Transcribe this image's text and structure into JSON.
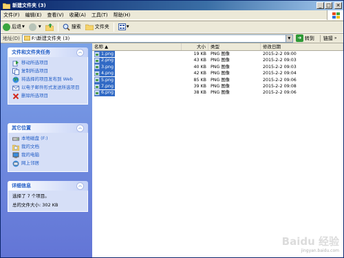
{
  "window": {
    "title": "新建文件夹 (3)",
    "buttons": [
      "_",
      "□",
      "✕"
    ]
  },
  "menu": [
    "文件(F)",
    "编辑(E)",
    "查看(V)",
    "收藏(A)",
    "工具(T)",
    "帮助(H)"
  ],
  "toolbar": {
    "back": "后退",
    "search": "搜索",
    "folders": "文件夹"
  },
  "address": {
    "label": "地址(D)",
    "path": "F:\\新建文件夹 (3)",
    "go": "转到",
    "links": "链接"
  },
  "panels": {
    "tasks": {
      "title": "文件和文件夹任务",
      "items": [
        "移动所选项目",
        "复制所选项目",
        "将选择的项目发布到 Web",
        "以电子邮件形式发送所选项目",
        "删除所选项目"
      ]
    },
    "places": {
      "title": "其它位置",
      "items": [
        "本地磁盘 (F:)",
        "我的文档",
        "我的电脑",
        "网上邻居"
      ]
    },
    "details": {
      "title": "详细信息",
      "lines": [
        "选择了 7 个项目。",
        "总的文件大小: 302 KB"
      ]
    }
  },
  "columns": {
    "name": "名称 ▲",
    "size": "大小",
    "type": "类型",
    "date": "修改日期"
  },
  "files": [
    {
      "name": "1.png",
      "size": "19 KB",
      "type": "PNG 图像",
      "date": "2015-2-2 09:00"
    },
    {
      "name": "2.png",
      "size": "43 KB",
      "type": "PNG 图像",
      "date": "2015-2-2 09:03"
    },
    {
      "name": "3.png",
      "size": "40 KB",
      "type": "PNG 图像",
      "date": "2015-2-2 09:03"
    },
    {
      "name": "4.png",
      "size": "42 KB",
      "type": "PNG 图像",
      "date": "2015-2-2 09:04"
    },
    {
      "name": "5.png",
      "size": "85 KB",
      "type": "PNG 图像",
      "date": "2015-2-2 09:06"
    },
    {
      "name": "7.png",
      "size": "39 KB",
      "type": "PNG 图像",
      "date": "2015-2-2 09:08"
    },
    {
      "name": "6.png",
      "size": "38 KB",
      "type": "PNG 图像",
      "date": "2015-2-2 09:06"
    }
  ],
  "watermark": {
    "line1": "Baidu 经验",
    "line2": "jingyan.baidu.com"
  },
  "colors": {
    "title_bar": "#0a246a",
    "selection": "#316ac5",
    "task_link": "#215dc6",
    "left_pane": "#7ba2e7"
  }
}
